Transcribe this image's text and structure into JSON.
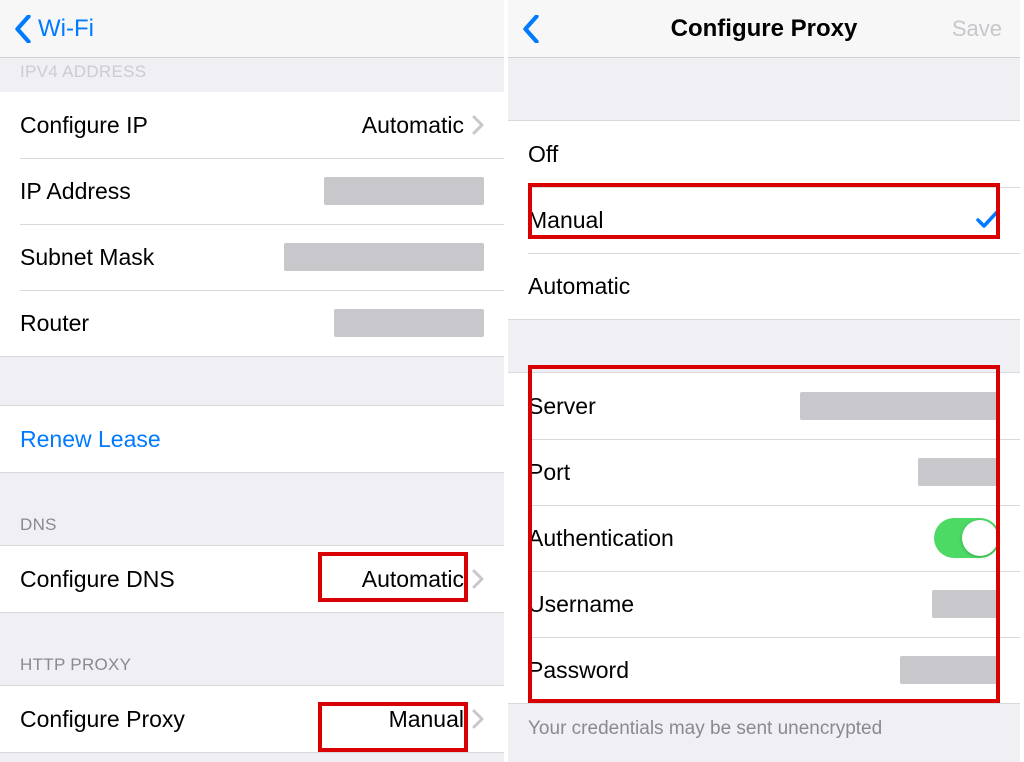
{
  "left": {
    "nav_back_label": "Wi-Fi",
    "section_ipv4_header": "IPV4 ADDRESS",
    "rows": {
      "configure_ip": {
        "label": "Configure IP",
        "value": "Automatic"
      },
      "ip_address": {
        "label": "IP Address"
      },
      "subnet_mask": {
        "label": "Subnet Mask"
      },
      "router": {
        "label": "Router"
      }
    },
    "renew_lease_label": "Renew Lease",
    "section_dns_header": "DNS",
    "configure_dns": {
      "label": "Configure DNS",
      "value": "Automatic"
    },
    "section_proxy_header": "HTTP PROXY",
    "configure_proxy": {
      "label": "Configure Proxy",
      "value": "Manual"
    }
  },
  "right": {
    "nav_title": "Configure Proxy",
    "nav_save_label": "Save",
    "options": {
      "off": "Off",
      "manual": "Manual",
      "automatic": "Automatic"
    },
    "selected": "manual",
    "fields": {
      "server": {
        "label": "Server"
      },
      "port": {
        "label": "Port"
      },
      "authentication": {
        "label": "Authentication",
        "on": true
      },
      "username": {
        "label": "Username"
      },
      "password": {
        "label": "Password"
      }
    },
    "footnote": "Your credentials may be sent unencrypted"
  },
  "colors": {
    "ios_blue": "#007aff",
    "ios_green": "#4cd964",
    "highlight_red": "#d80000"
  }
}
